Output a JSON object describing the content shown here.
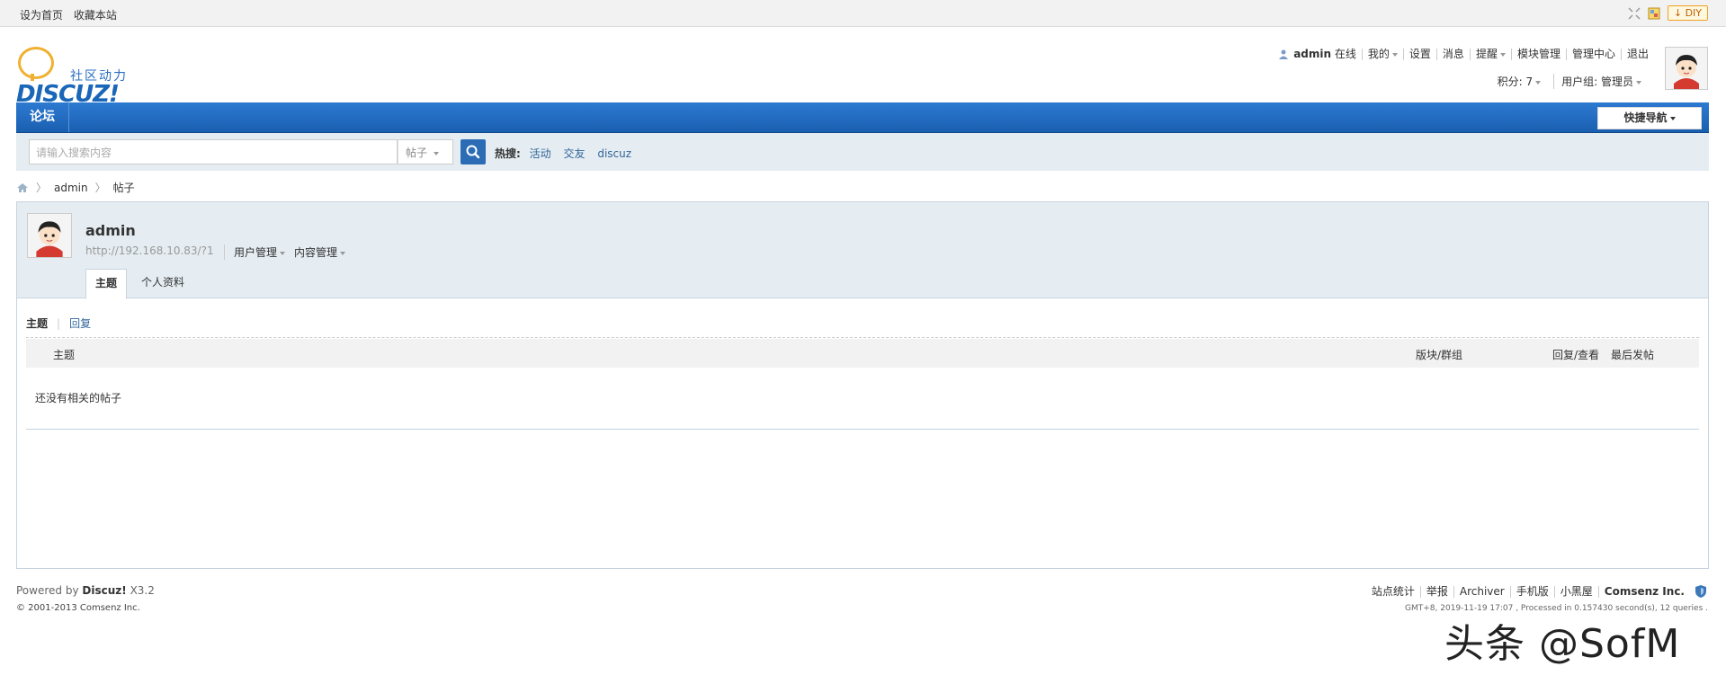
{
  "topbar": {
    "set_homepage": "设为首页",
    "bookmark": "收藏本站",
    "diy": "DIY"
  },
  "logo": {
    "tagline": "社区动力",
    "wordmark": "DISCUZ!"
  },
  "user_nav": {
    "username": "admin",
    "online": "在线",
    "mine": "我的",
    "settings": "设置",
    "messages": "消息",
    "reminders": "提醒",
    "module_manage": "模块管理",
    "admin_center": "管理中心",
    "logout": "退出",
    "points": "积分: 7",
    "user_group": "用户组: 管理员"
  },
  "nav": {
    "forum": "论坛",
    "quick_nav": "快捷导航"
  },
  "search": {
    "placeholder": "请输入搜索内容",
    "type": "帖子",
    "hot_label": "热搜:",
    "hot": [
      "活动",
      "交友",
      "discuz"
    ]
  },
  "breadcrumb": {
    "items": [
      "admin",
      "帖子"
    ]
  },
  "profile": {
    "name": "admin",
    "url": "http://192.168.10.83/?1",
    "user_manage": "用户管理",
    "content_manage": "内容管理",
    "tabs": [
      "主题",
      "个人资料"
    ]
  },
  "threads": {
    "subtabs": [
      "主题",
      "回复"
    ],
    "columns": [
      "主题",
      "版块/群组",
      "回复/查看",
      "最后发帖"
    ],
    "empty": "还没有相关的帖子"
  },
  "footer": {
    "powered_by": "Powered by",
    "product": "Discuz!",
    "version": "X3.2",
    "copyright": "© 2001-2013 Comsenz Inc.",
    "links": [
      "站点统计",
      "举报",
      "Archiver",
      "手机版",
      "小黑屋"
    ],
    "company": "Comsenz Inc.",
    "timing": "GMT+8, 2019-11-19 17:07 , Processed in 0.157430 second(s), 12 queries ."
  },
  "watermark": "头条 @SofM",
  "colors": {
    "nav_blue": "#1a5fb0",
    "link_blue": "#336699",
    "panel_bg": "#e5edf2"
  }
}
